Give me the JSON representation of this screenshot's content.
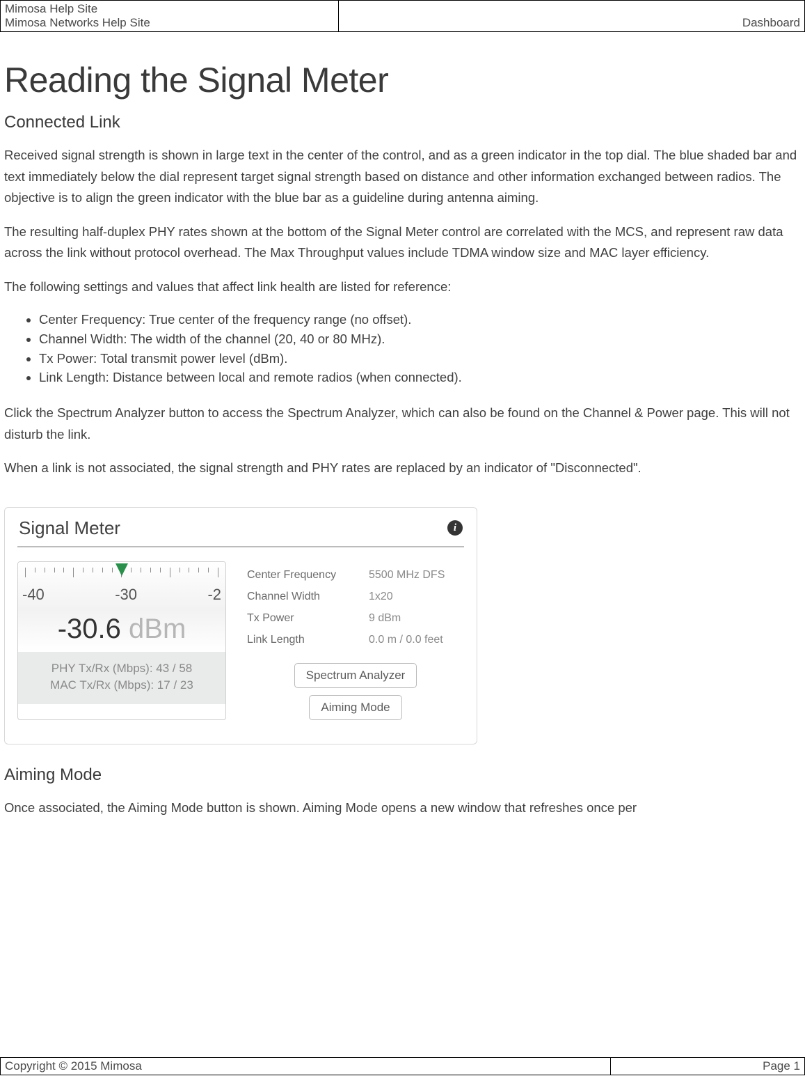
{
  "header": {
    "site_line1": "Mimosa Help Site",
    "site_line2": "Mimosa Networks Help Site",
    "breadcrumb": "Dashboard"
  },
  "page": {
    "title": "Reading the Signal Meter",
    "section1_heading": "Connected Link",
    "para1": "Received signal strength is shown in large text in the center of the control, and as a green indicator in the top dial. The blue shaded bar and text immediately below the dial represent target signal strength based on distance and other information exchanged between radios. The objective is to align the green indicator with the blue bar as a guideline during antenna aiming.",
    "para2": "The resulting half-duplex PHY rates shown at the bottom of the Signal Meter control are correlated with the MCS, and represent raw data across the link without protocol overhead. The Max Throughput values include TDMA window size and MAC layer efficiency.",
    "para3": "The following settings and values that affect link health are listed for reference:",
    "bullets": [
      "Center Frequency: True center of the frequency range (no offset).",
      "Channel Width: The width of the channel (20, 40 or 80 MHz).",
      "Tx Power: Total transmit power level (dBm).",
      "Link Length: Distance between local and remote radios (when connected)."
    ],
    "para4": "Click the Spectrum Analyzer button to access the Spectrum Analyzer, which can also be found on the Channel & Power page. This will not disturb the link.",
    "para5": "When a link is not associated, the signal strength and PHY rates are replaced by an indicator of \"Disconnected\".",
    "section2_heading": "Aiming Mode",
    "para6": "Once associated, the Aiming Mode button is shown.  Aiming Mode opens a new window that refreshes once per"
  },
  "signal_meter": {
    "card_title": "Signal Meter",
    "ruler_labels": {
      "left": "-40",
      "center": "-30",
      "right": "-2"
    },
    "dbm_value": "-30.6",
    "dbm_unit": " dBm",
    "phy_line": "PHY Tx/Rx (Mbps): 43 / 58",
    "mac_line": "MAC Tx/Rx (Mbps): 17 / 23",
    "kv": {
      "center_freq_label": "Center Frequency",
      "center_freq_value": "5500 MHz DFS",
      "channel_width_label": "Channel Width",
      "channel_width_value": "1x20",
      "tx_power_label": "Tx Power",
      "tx_power_value": "9 dBm",
      "link_length_label": "Link Length",
      "link_length_value": "0.0 m / 0.0 feet"
    },
    "buttons": {
      "spectrum_analyzer": "Spectrum Analyzer",
      "aiming_mode": "Aiming Mode"
    }
  },
  "footer": {
    "copyright": "Copyright © 2015 Mimosa",
    "page_number": "Page 1"
  }
}
